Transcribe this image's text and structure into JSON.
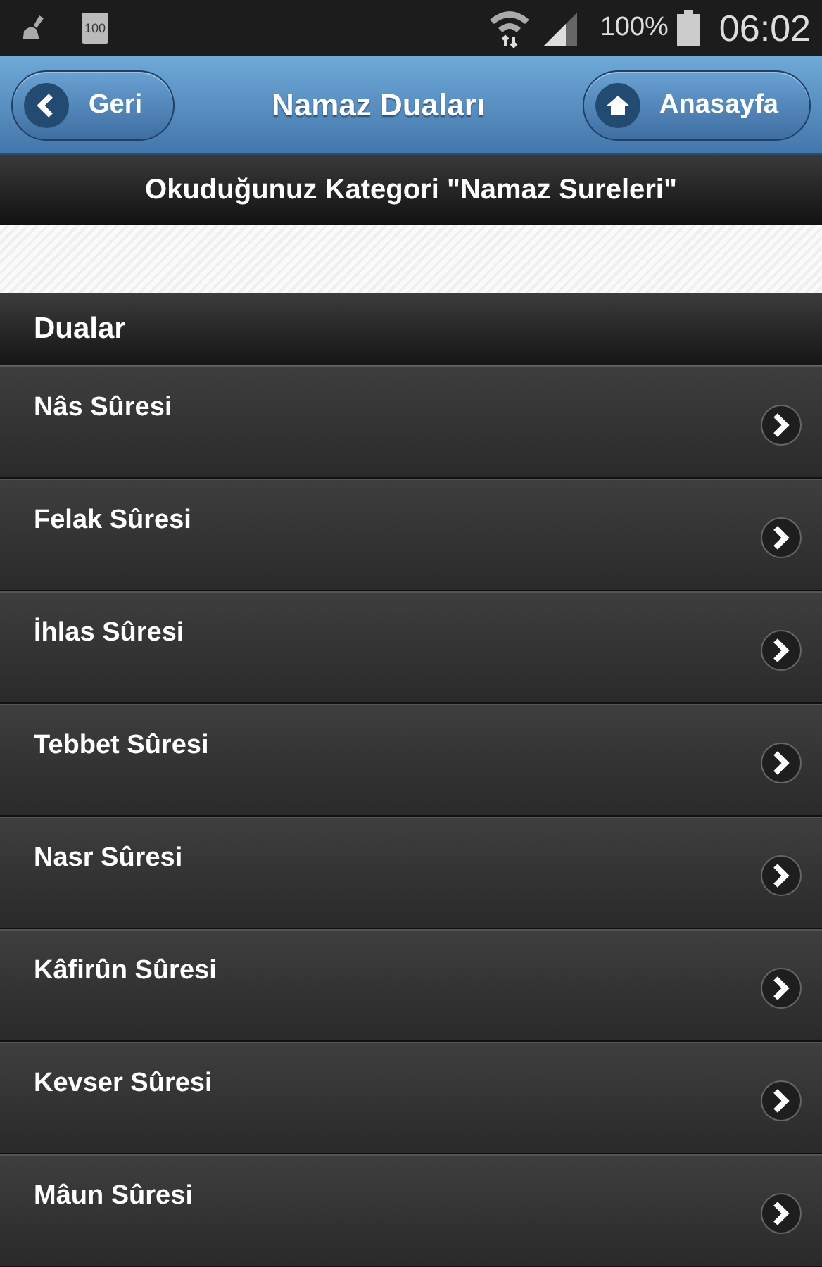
{
  "status_bar": {
    "battery_badge": "100",
    "battery_percent": "100%",
    "time": "06:02"
  },
  "header": {
    "back_button": "Geri",
    "title": "Namaz Duaları",
    "home_button": "Anasayfa"
  },
  "category_bar": {
    "text": "Okuduğunuz Kategori \"Namaz Sureleri\""
  },
  "list": {
    "heading": "Dualar",
    "items": [
      {
        "label": "Nâs Sûresi"
      },
      {
        "label": "Felak Sûresi"
      },
      {
        "label": "İhlas Sûresi"
      },
      {
        "label": "Tebbet Sûresi"
      },
      {
        "label": "Nasr Sûresi"
      },
      {
        "label": "Kâfirûn Sûresi"
      },
      {
        "label": "Kevser Sûresi"
      },
      {
        "label": "Mâun Sûresi"
      }
    ]
  }
}
